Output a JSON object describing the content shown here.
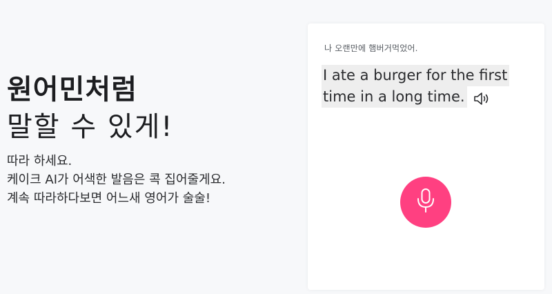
{
  "hero": {
    "title_bold": "원어민처럼",
    "title_light": "말할 수 있게!",
    "description": [
      "따라 하세요.",
      "케이크 AI가 어색한 발음은 콕 집어줄게요.",
      "계속 따라하다보면 어느새 영어가 술술!"
    ]
  },
  "card": {
    "korean_sentence": "나 오랜만에 햄버거먹었어.",
    "english_lines": [
      "I ate a burger for the first",
      "time in a long time."
    ],
    "speaker_icon": "speaker-icon",
    "mic_icon": "microphone-icon"
  },
  "colors": {
    "background": "#f7f8fa",
    "card": "#ffffff",
    "mic_button": "#ff4081",
    "highlight": "#eeeeee",
    "text": "#1c1d20"
  }
}
